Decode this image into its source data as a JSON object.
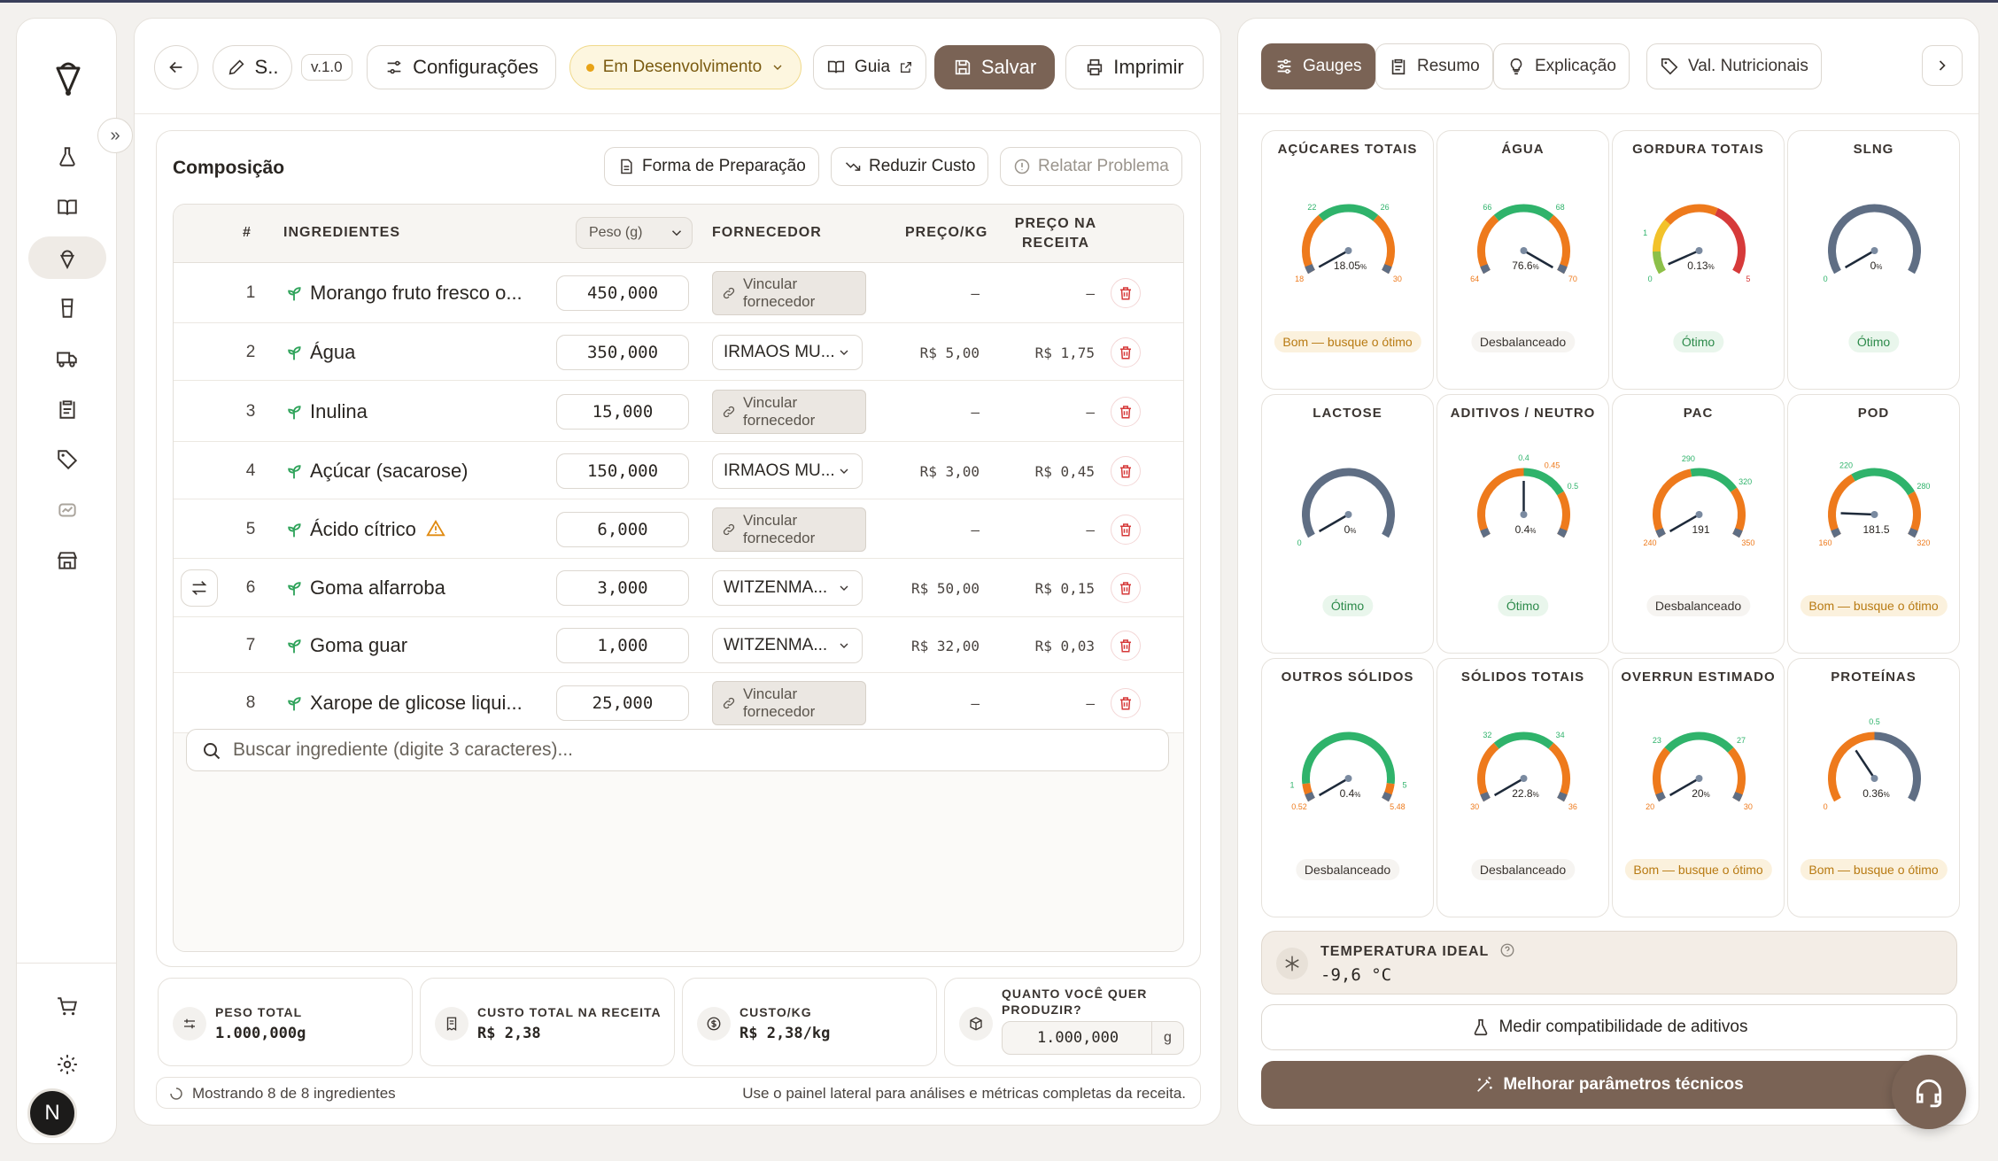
{
  "toolbar": {
    "recipe_name": "S..",
    "version": "v.1.0",
    "config_label": "Configurações",
    "status_label": "Em Desenvolvimento",
    "guide_label": "Guia",
    "save_label": "Salvar",
    "print_label": "Imprimir"
  },
  "composition": {
    "title": "Composição",
    "actions": {
      "preparation": "Forma de Preparação",
      "reduce_cost": "Reduzir Custo",
      "report": "Relatar Problema"
    },
    "headers": {
      "num": "#",
      "ingredients": "INGREDIENTES",
      "weight_unit": "Peso (g)",
      "supplier": "FORNECEDOR",
      "price_kg": "PREÇO/KG",
      "price_recipe_1": "PREÇO NA",
      "price_recipe_2": "RECEITA"
    },
    "link_supplier_1": "Vincular",
    "link_supplier_2": "fornecedor",
    "rows": [
      {
        "num": "1",
        "name": "Morango fruto fresco o...",
        "qty": "450,000",
        "supplier": "",
        "price_kg": "–",
        "price_recipe": "–"
      },
      {
        "num": "2",
        "name": "Água",
        "qty": "350,000",
        "supplier": "IRMAOS MU...",
        "price_kg": "R$ 5,00",
        "price_recipe": "R$ 1,75"
      },
      {
        "num": "3",
        "name": "Inulina",
        "qty": "15,000",
        "supplier": "",
        "price_kg": "–",
        "price_recipe": "–"
      },
      {
        "num": "4",
        "name": "Açúcar (sacarose)",
        "qty": "150,000",
        "supplier": "IRMAOS MU...",
        "price_kg": "R$ 3,00",
        "price_recipe": "R$ 0,45"
      },
      {
        "num": "5",
        "name": "Ácido cítrico",
        "qty": "6,000",
        "supplier": "",
        "price_kg": "–",
        "price_recipe": "–"
      },
      {
        "num": "6",
        "name": "Goma alfarroba",
        "qty": "3,000",
        "supplier": "WITZENMA...",
        "price_kg": "R$ 50,00",
        "price_recipe": "R$ 0,15"
      },
      {
        "num": "7",
        "name": "Goma guar",
        "qty": "1,000",
        "supplier": "WITZENMA...",
        "price_kg": "R$ 32,00",
        "price_recipe": "R$ 0,03"
      },
      {
        "num": "8",
        "name": "Xarope de glicose liqui...",
        "qty": "25,000",
        "supplier": "",
        "price_kg": "–",
        "price_recipe": "–"
      }
    ],
    "search_placeholder": "Buscar ingrediente (digite 3 caracteres)..."
  },
  "stats": {
    "total_weight_label": "PESO TOTAL",
    "total_weight": "1.000,000g",
    "total_cost_label": "CUSTO TOTAL NA RECEITA",
    "total_cost": "R$ 2,38",
    "cost_kg_label": "CUSTO/KG",
    "cost_kg": "R$ 2,38/kg",
    "produce_label_1": "QUANTO VOCÊ QUER",
    "produce_label_2": "PRODUZIR?",
    "produce_value": "1.000,000",
    "produce_unit": "g"
  },
  "footer": {
    "showing": "Mostrando 8 de 8 ingredientes",
    "hint": "Use o painel lateral para análises e métricas completas da receita."
  },
  "right_tabs": {
    "gauges": "Gauges",
    "summary": "Resumo",
    "explanation": "Explicação",
    "nutrition": "Val. Nutricionais"
  },
  "gauges": [
    {
      "title": "AÇÚCARES TOTAIS",
      "value": 18.05,
      "display": "18.05",
      "unit": "%",
      "min": 18,
      "max": 30,
      "opt_lo": 22,
      "opt_hi": 26,
      "labels": [
        "18",
        "22",
        "26",
        "30"
      ],
      "badge": "Bom — busque o ótimo",
      "status": "warn"
    },
    {
      "title": "ÁGUA",
      "value": 76.6,
      "display": "76.6",
      "unit": "%",
      "min": 64,
      "max": 70,
      "opt_lo": 66,
      "opt_hi": 68,
      "labels": [
        "64",
        "66",
        "68",
        "70"
      ],
      "badge": "Desbalanceado",
      "status": "bad"
    },
    {
      "title": "GORDURA TOTAIS",
      "value": 0.13,
      "display": "0.13",
      "unit": "%",
      "min": 0,
      "max": 5,
      "opt_lo": 1,
      "opt_hi": 3.5,
      "labels": [
        "0",
        "1",
        "5"
      ],
      "badge": "Ótimo",
      "status": "good",
      "style": "fat"
    },
    {
      "title": "SLNG",
      "value": 0,
      "display": "0",
      "unit": "%",
      "min": 0,
      "max": 12,
      "labels": [
        "0"
      ],
      "badge": "Ótimo",
      "status": "good",
      "style": "plain"
    },
    {
      "title": "LACTOSE",
      "value": 0,
      "display": "0",
      "unit": "%",
      "min": 0,
      "max": 10,
      "labels": [
        "0"
      ],
      "badge": "Ótimo",
      "status": "good",
      "style": "plain"
    },
    {
      "title": "ADITIVOS / NEUTRO",
      "value": 0.4,
      "display": "0.4",
      "unit": "%",
      "min": 0.2,
      "max": 0.6,
      "opt_lo": 0.4,
      "opt_hi": 0.5,
      "labels": [
        "0.4",
        "0.45",
        "0.5"
      ],
      "badge": "Ótimo",
      "status": "good"
    },
    {
      "title": "PAC",
      "value": 191,
      "display": "191",
      "unit": "",
      "min": 240,
      "max": 350,
      "opt_lo": 290,
      "opt_hi": 320,
      "labels": [
        "240",
        "290",
        "320",
        "350"
      ],
      "badge": "Desbalanceado",
      "status": "bad"
    },
    {
      "title": "POD",
      "value": 181.5,
      "display": "181.5",
      "unit": "",
      "min": 160,
      "max": 320,
      "opt_lo": 220,
      "opt_hi": 280,
      "labels": [
        "160",
        "220",
        "280",
        "320"
      ],
      "badge": "Bom — busque o ótimo",
      "status": "warn"
    },
    {
      "title": "OUTROS SÓLIDOS",
      "value": 0.4,
      "display": "0.4",
      "unit": "%",
      "min": 0.52,
      "max": 5.48,
      "opt_lo": 1,
      "opt_hi": 5,
      "labels": [
        "0.52",
        "1",
        "5",
        "5.48"
      ],
      "badge": "Desbalanceado",
      "status": "bad"
    },
    {
      "title": "SÓLIDOS TOTAIS",
      "value": 22.8,
      "display": "22.8",
      "unit": "%",
      "min": 30,
      "max": 36,
      "opt_lo": 32,
      "opt_hi": 34,
      "labels": [
        "30",
        "32",
        "34",
        "36"
      ],
      "badge": "Desbalanceado",
      "status": "bad"
    },
    {
      "title": "OVERRUN ESTIMADO",
      "value": 20,
      "display": "20",
      "unit": "%",
      "min": 20,
      "max": 30,
      "opt_lo": 23,
      "opt_hi": 27,
      "labels": [
        "20",
        "23",
        "27",
        "30"
      ],
      "badge": "Bom — busque o ótimo",
      "status": "warn"
    },
    {
      "title": "PROTEÍNAS",
      "value": 0.36,
      "display": "0.36",
      "unit": "%",
      "min": 0,
      "max": 1,
      "opt_lo": 0.5,
      "opt_hi": 0.5,
      "labels": [
        "0",
        "0.5"
      ],
      "badge": "Bom — busque o ótimo",
      "status": "warn",
      "style": "prot"
    }
  ],
  "temperature": {
    "label": "TEMPERATURA IDEAL",
    "value": "-9,6 °C"
  },
  "measure_label": "Medir compatibilidade de aditivos",
  "improve_label": "Melhorar parâmetros técnicos",
  "user_initial": "N",
  "colors": {
    "accent": "#7a6355",
    "gauge_green": "#2fb36b",
    "gauge_orange": "#ee7a1c",
    "gauge_slate": "#5f6e84",
    "delete_red": "#d63a3a"
  }
}
